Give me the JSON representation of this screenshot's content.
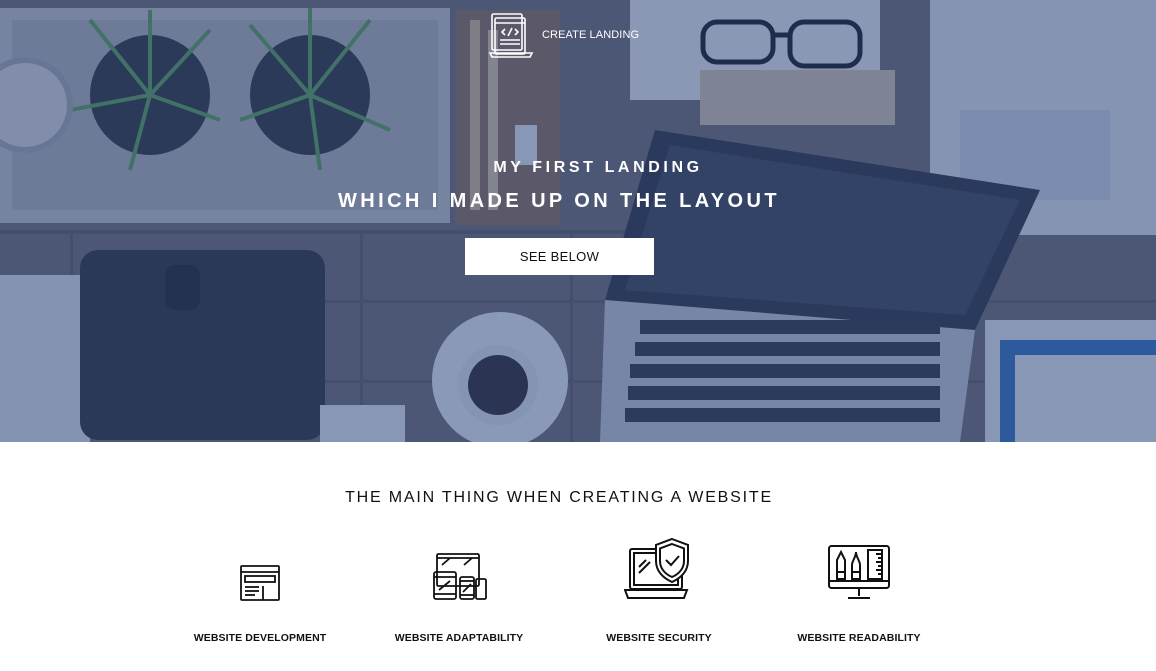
{
  "hero": {
    "logo_text": "CREATE LANDING",
    "title_line1": "MY FIRST LANDING",
    "title_line2": "WHICH I MADE UP ON THE LAYOUT",
    "cta_label": "SEE BELOW"
  },
  "features": {
    "heading": "THE MAIN THING WHEN CREATING A WEBSITE",
    "items": [
      {
        "label": "WEBSITE DEVELOPMENT",
        "icon": "browser-window-icon"
      },
      {
        "label": "WEBSITE ADAPTABILITY",
        "icon": "responsive-devices-icon"
      },
      {
        "label": "WEBSITE SECURITY",
        "icon": "shield-laptop-icon"
      },
      {
        "label": "WEBSITE READABILITY",
        "icon": "design-tools-monitor-icon"
      }
    ]
  },
  "colors": {
    "overlay": "#2c4682",
    "button_bg": "#ffffff",
    "text_dark": "#111111",
    "text_light": "#ffffff"
  }
}
